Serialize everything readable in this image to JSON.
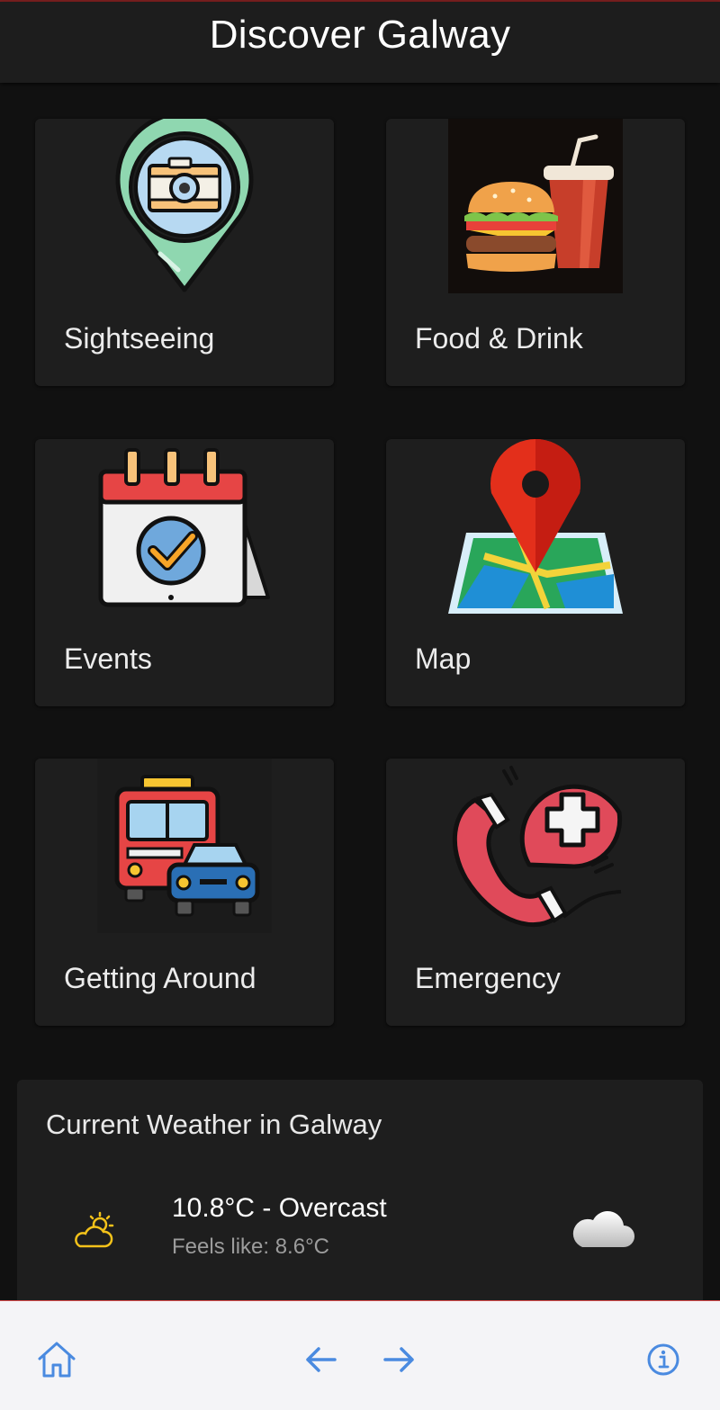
{
  "header": {
    "title": "Discover Galway"
  },
  "categories": [
    {
      "label": "Sightseeing",
      "icon": "map-pin-camera-icon"
    },
    {
      "label": "Food & Drink",
      "icon": "burger-drink-icon"
    },
    {
      "label": "Events",
      "icon": "calendar-check-icon"
    },
    {
      "label": "Map",
      "icon": "folded-map-pin-icon"
    },
    {
      "label": "Getting Around",
      "icon": "bus-car-icon"
    },
    {
      "label": "Emergency",
      "icon": "emergency-phone-icon"
    }
  ],
  "weather": {
    "title": "Current Weather in Galway",
    "temperature": "10.8°C - Overcast",
    "feels_like": "Feels like: 8.6°C",
    "small_icon": "partly-cloudy-icon",
    "condition_icon": "cloud-icon"
  },
  "bottom_nav": {
    "items": [
      "home-icon",
      "back-arrow-icon",
      "forward-arrow-icon",
      "info-icon"
    ]
  },
  "colors": {
    "background": "#111111",
    "card": "#1e1e1e",
    "nav_icon": "#4a8ae0",
    "nav_bar": "#f4f4f7",
    "weather_small_icon": "#f3c21a"
  }
}
